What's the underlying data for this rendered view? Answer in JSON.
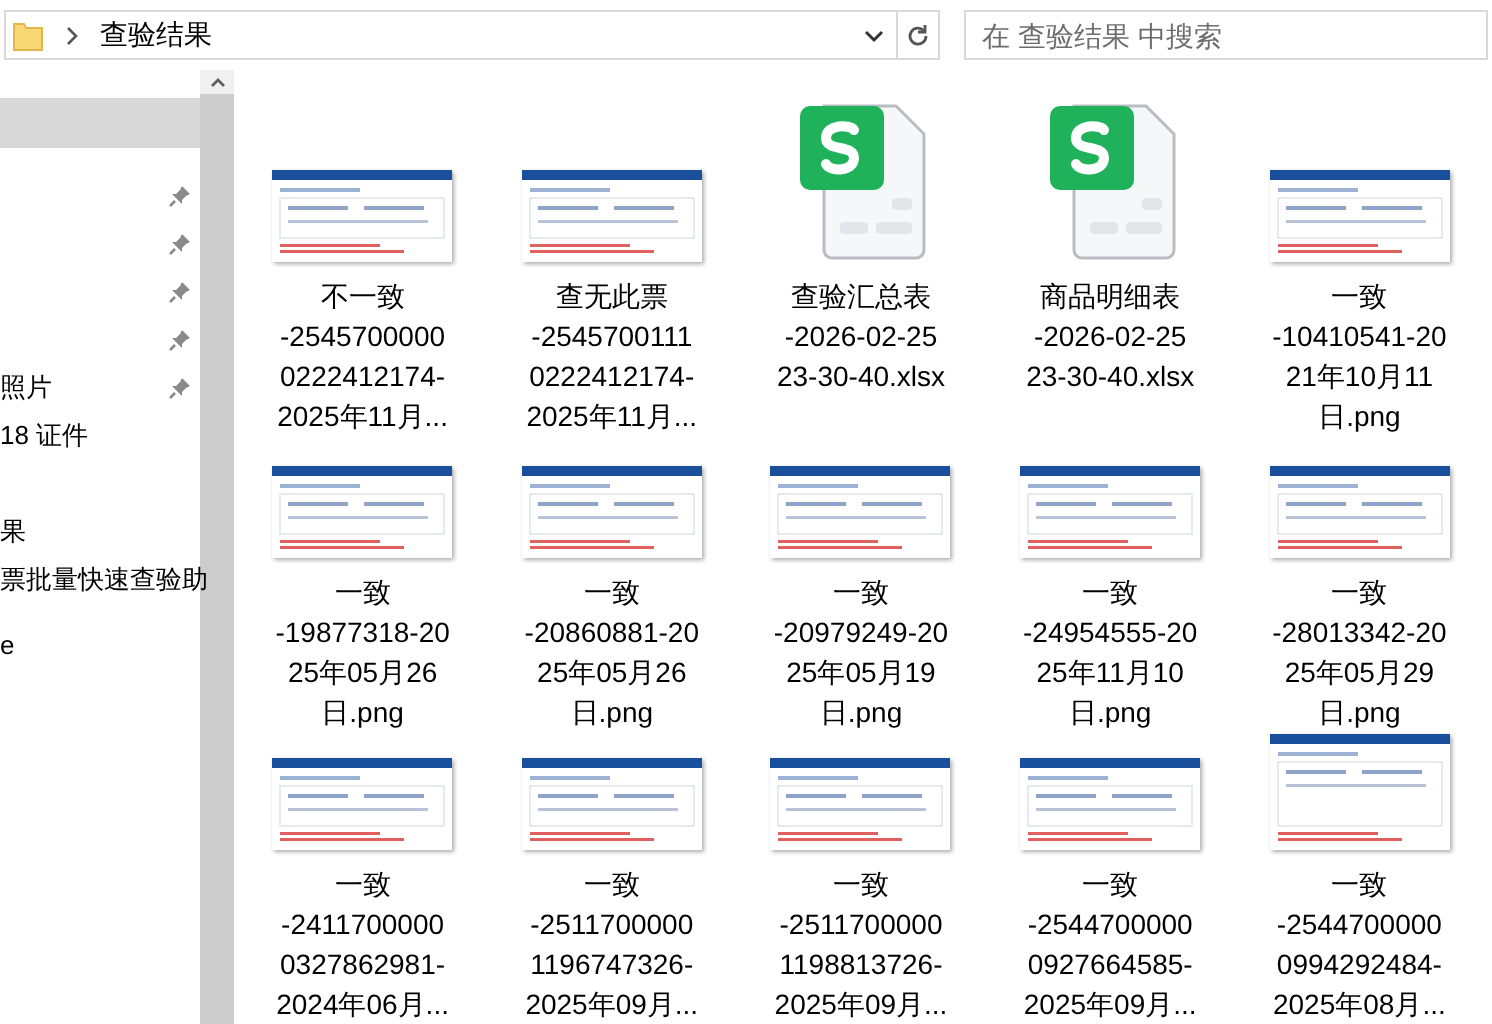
{
  "address_bar": {
    "path": [
      "查验结果"
    ]
  },
  "search": {
    "placeholder": "在 查验结果 中搜索"
  },
  "sidebar": {
    "items": [
      {
        "selected": true,
        "pinned": false
      },
      {
        "selected": false,
        "pinned": true
      },
      {
        "selected": false,
        "pinned": true
      },
      {
        "selected": false,
        "pinned": true
      },
      {
        "selected": false,
        "pinned": true
      },
      {
        "label": "照片",
        "selected": false,
        "pinned": true
      },
      {
        "label": "18 证件",
        "selected": false,
        "pinned": false
      },
      {
        "label": "果",
        "selected": false,
        "pinned": false
      },
      {
        "label": "票批量快速查验助",
        "selected": false,
        "pinned": false
      },
      {
        "label": "e",
        "selected": false,
        "pinned": false
      }
    ]
  },
  "files": [
    {
      "name_lines": [
        "不一致",
        "-2545700000",
        "0222412174-",
        "2025年11月..."
      ]
    },
    {
      "name_lines": [
        "查无此票",
        "-2545700111",
        "0222412174-",
        "2025年11月..."
      ]
    },
    {
      "kind": "spreadsheet",
      "name_lines": [
        "查验汇总表",
        "-2026-02-25",
        "23-30-40.xlsx"
      ]
    },
    {
      "kind": "spreadsheet",
      "name_lines": [
        "商品明细表",
        "-2026-02-25",
        "23-30-40.xlsx"
      ]
    },
    {
      "name_lines": [
        "一致",
        "-10410541-20",
        "21年10月11",
        "日.png"
      ]
    },
    {
      "name_lines": [
        "一致",
        "-19877318-20",
        "25年05月26",
        "日.png"
      ]
    },
    {
      "name_lines": [
        "一致",
        "-20860881-20",
        "25年05月26",
        "日.png"
      ]
    },
    {
      "name_lines": [
        "一致",
        "-20979249-20",
        "25年05月19",
        "日.png"
      ]
    },
    {
      "name_lines": [
        "一致",
        "-24954555-20",
        "25年11月10",
        "日.png"
      ]
    },
    {
      "name_lines": [
        "一致",
        "-28013342-20",
        "25年05月29",
        "日.png"
      ]
    },
    {
      "name_lines": [
        "一致",
        "-2411700000",
        "0327862981-",
        "2024年06月..."
      ]
    },
    {
      "name_lines": [
        "一致",
        "-2511700000",
        "1196747326-",
        "2025年09月..."
      ]
    },
    {
      "name_lines": [
        "一致",
        "-2511700000",
        "1198813726-",
        "2025年09月..."
      ]
    },
    {
      "name_lines": [
        "一致",
        "-2544700000",
        "0927664585-",
        "2025年09月..."
      ]
    },
    {
      "name_lines": [
        "一致",
        "-2544700000",
        "0994292484-",
        "2025年08月..."
      ]
    }
  ]
}
